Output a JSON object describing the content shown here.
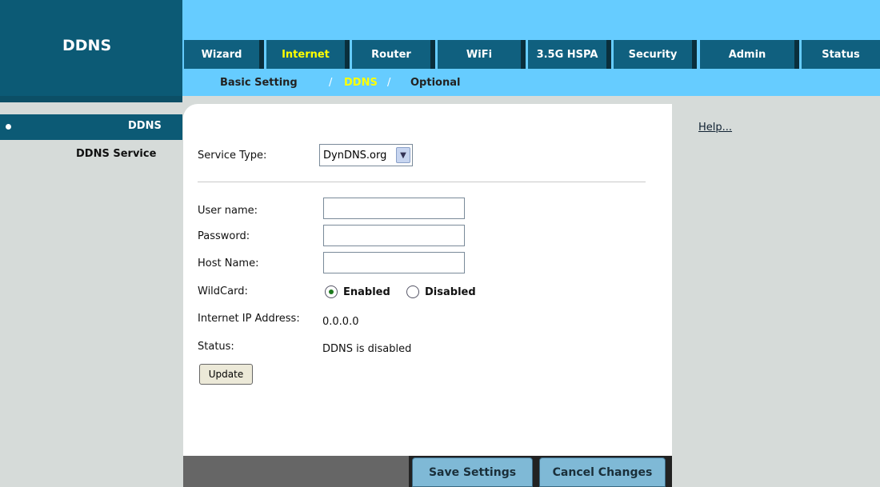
{
  "header": {
    "title": "DDNS"
  },
  "tabs": [
    {
      "label": "Wizard",
      "active": false
    },
    {
      "label": "Internet",
      "active": true
    },
    {
      "label": "Router",
      "active": false
    },
    {
      "label": "WiFi",
      "active": false
    },
    {
      "label": "3.5G HSPA",
      "active": false
    },
    {
      "label": "Security",
      "active": false
    },
    {
      "label": "Admin",
      "active": false
    },
    {
      "label": "Status",
      "active": false
    }
  ],
  "subtabs": [
    {
      "label": "Basic Setting",
      "active": false
    },
    {
      "label": "DDNS",
      "active": true
    },
    {
      "label": "Optional",
      "active": false
    }
  ],
  "subtab_separator": "/",
  "sidebar": {
    "section": "DDNS",
    "items": [
      {
        "label": "DDNS Service"
      }
    ]
  },
  "help": {
    "link": "Help..."
  },
  "form": {
    "service_type": {
      "label": "Service Type:",
      "value": "DynDNS.org"
    },
    "username": {
      "label": "User name:",
      "value": ""
    },
    "password": {
      "label": "Password:",
      "value": ""
    },
    "host_name": {
      "label": "Host Name:",
      "value": ""
    },
    "wildcard": {
      "label": "WildCard:",
      "options": [
        "Enabled",
        "Disabled"
      ],
      "selected": "Enabled"
    },
    "internet_ip": {
      "label": "Internet IP Address:",
      "value": "0.0.0.0"
    },
    "status": {
      "label": "Status:",
      "value": "DDNS is disabled"
    },
    "update_button": "Update"
  },
  "footer": {
    "save_label": "Save Settings",
    "cancel_label": "Cancel Changes"
  },
  "colors": {
    "accent_dark": "#0c5a75",
    "top_bar": "#66ccff",
    "active_tab_text": "#ffff00",
    "background": "#d6dbd9"
  }
}
